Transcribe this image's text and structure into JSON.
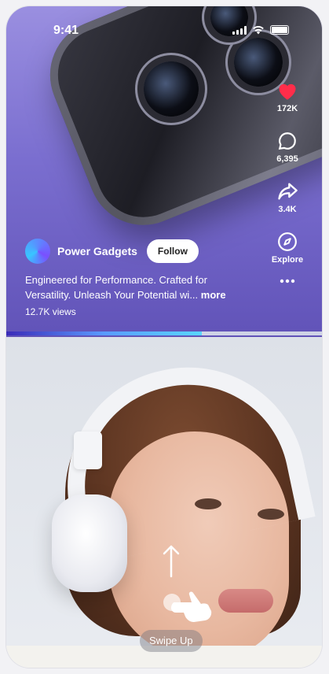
{
  "status_bar": {
    "time": "9:41"
  },
  "post": {
    "channel_name": "Power Gadgets",
    "follow_label": "Follow",
    "caption_text": "Engineered for Performance. Crafted for Versatility.  Unleash Your Potential wi...",
    "more_label": "more",
    "views": "12.7K views",
    "progress_fraction": 0.62
  },
  "actions": {
    "like_count": "172K",
    "comment_count": "6,395",
    "share_count": "3.4K",
    "explore_label": "Explore"
  },
  "swipe_hint": {
    "label": "Swipe Up"
  },
  "colors": {
    "like": "#ff2d4a",
    "accent": "#5a3fd8"
  },
  "icons": [
    "heart-icon",
    "comment-icon",
    "share-icon",
    "explore-icon",
    "more-icon",
    "arrow-up-icon",
    "hand-swipe-icon"
  ]
}
